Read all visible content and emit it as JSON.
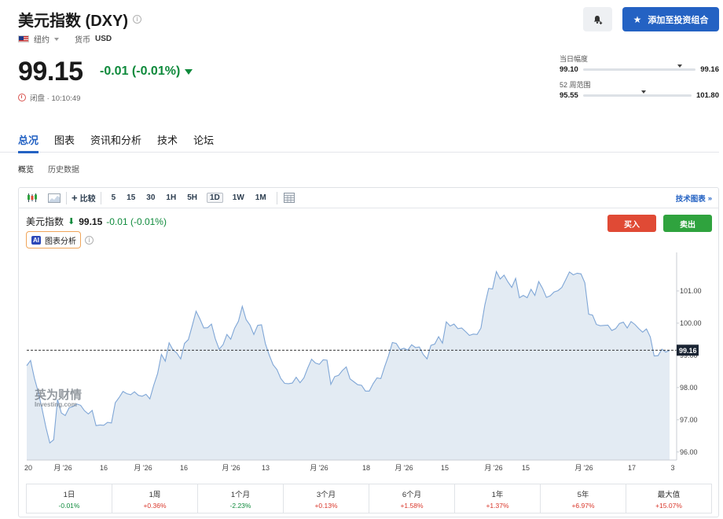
{
  "header": {
    "title": "美元指数 (DXY)",
    "exchange": "纽约",
    "currency_label": "货币",
    "currency": "USD",
    "price": "99.15",
    "change": "-0.01 (-0.01%)",
    "status": "闭盘 · 10:10:49",
    "add_portfolio_label": "添加至投资组合"
  },
  "ranges": {
    "day_label": "当日幅度",
    "day_low": "99.10",
    "day_high": "99.16",
    "day_position": 0.86,
    "week52_label": "52 周范围",
    "week52_low": "95.55",
    "week52_high": "101.80",
    "week52_position": 0.56
  },
  "tabs": [
    {
      "label": "总况",
      "active": true
    },
    {
      "label": "图表",
      "active": false
    },
    {
      "label": "资讯和分析",
      "active": false
    },
    {
      "label": "技术",
      "active": false
    },
    {
      "label": "论坛",
      "active": false
    }
  ],
  "subtabs": [
    {
      "label": "概览",
      "active": true
    },
    {
      "label": "历史数据",
      "active": false
    }
  ],
  "toolbar": {
    "compare_label": "比较",
    "timeframes": [
      "5",
      "15",
      "30",
      "1H",
      "5H",
      "1D",
      "1W",
      "1M"
    ],
    "active_timeframe": "1D",
    "tech_chart_label": "技术图表"
  },
  "chart_header": {
    "name": "美元指数",
    "price": "99.15",
    "change": "-0.01 (-0.01%)",
    "ai_label": "图表分析",
    "ai_badge": "AI",
    "buy_label": "买入",
    "sell_label": "卖出"
  },
  "watermark": {
    "line1": "英为财情",
    "line2": "Investing.com"
  },
  "chart_data": {
    "type": "area",
    "title": "",
    "xlabel": "",
    "ylabel": "",
    "ylim": [
      95.75,
      102.0
    ],
    "yticks": [
      "96.00",
      "97.00",
      "98.00",
      "99.00",
      "100.00",
      "101.00"
    ],
    "current_value": "99.16",
    "x_tick_labels": [
      "20",
      "月 '26",
      "16",
      "月 '26",
      "16",
      "月 '26",
      "13",
      "月 '26",
      "18",
      "月 '26",
      "15",
      "月 '26",
      "15",
      "月 '26",
      "17",
      "3"
    ],
    "colors": {
      "line": "#7fa6d6",
      "fill": "#e3ebf3",
      "price_tag": "#1a2433"
    },
    "values": [
      98.68,
      98.84,
      98.29,
      97.86,
      97.33,
      96.76,
      96.28,
      96.38,
      97.63,
      97.21,
      97.13,
      97.37,
      97.41,
      97.49,
      97.45,
      97.28,
      97.18,
      97.29,
      96.82,
      96.84,
      96.83,
      96.92,
      96.9,
      97.53,
      97.69,
      97.88,
      97.81,
      97.78,
      97.87,
      97.76,
      97.73,
      97.79,
      97.65,
      98.07,
      98.43,
      99.03,
      98.82,
      99.39,
      99.17,
      99.07,
      98.89,
      99.37,
      99.49,
      99.92,
      100.37,
      100.13,
      99.85,
      99.86,
      99.97,
      99.51,
      99.19,
      99.33,
      99.65,
      99.5,
      99.84,
      100.06,
      100.52,
      100.11,
      99.94,
      99.65,
      99.93,
      99.95,
      99.36,
      99.01,
      98.71,
      98.56,
      98.28,
      98.13,
      98.12,
      98.14,
      98.32,
      98.15,
      98.3,
      98.61,
      98.88,
      98.76,
      98.72,
      98.86,
      98.85,
      98.1,
      98.34,
      98.38,
      98.53,
      98.64,
      98.27,
      98.18,
      98.09,
      98.07,
      97.89,
      97.89,
      98.12,
      98.3,
      98.28,
      98.65,
      98.99,
      99.4,
      99.37,
      99.18,
      99.22,
      99.16,
      99.33,
      99.24,
      99.26,
      99.03,
      98.89,
      99.31,
      99.35,
      99.58,
      99.38,
      100.04,
      99.91,
      99.97,
      99.83,
      99.85,
      99.74,
      99.62,
      99.66,
      99.65,
      99.85,
      100.56,
      101.08,
      101.06,
      101.6,
      101.37,
      101.49,
      101.28,
      101.11,
      101.39,
      100.79,
      100.86,
      100.79,
      101.05,
      100.86,
      101.29,
      101.08,
      100.8,
      100.85,
      100.97,
      101.01,
      101.11,
      101.34,
      101.59,
      101.5,
      101.55,
      101.53,
      101.25,
      100.28,
      100.25,
      99.96,
      99.92,
      99.93,
      99.94,
      99.77,
      99.83,
      99.99,
      100.03,
      99.85,
      100.05,
      99.96,
      99.83,
      99.72,
      99.82,
      99.57,
      98.98,
      98.99,
      99.19,
      99.1,
      99.15
    ]
  },
  "performance": [
    {
      "label": "1日",
      "value": "-0.01%",
      "dir": "neg"
    },
    {
      "label": "1周",
      "value": "+0.36%",
      "dir": "pos"
    },
    {
      "label": "1个月",
      "value": "-2.23%",
      "dir": "neg"
    },
    {
      "label": "3个月",
      "value": "+0.13%",
      "dir": "pos"
    },
    {
      "label": "6个月",
      "value": "+1.58%",
      "dir": "pos"
    },
    {
      "label": "1年",
      "value": "+1.37%",
      "dir": "pos"
    },
    {
      "label": "5年",
      "value": "+6.97%",
      "dir": "pos"
    },
    {
      "label": "最大值",
      "value": "+15.07%",
      "dir": "pos"
    }
  ]
}
